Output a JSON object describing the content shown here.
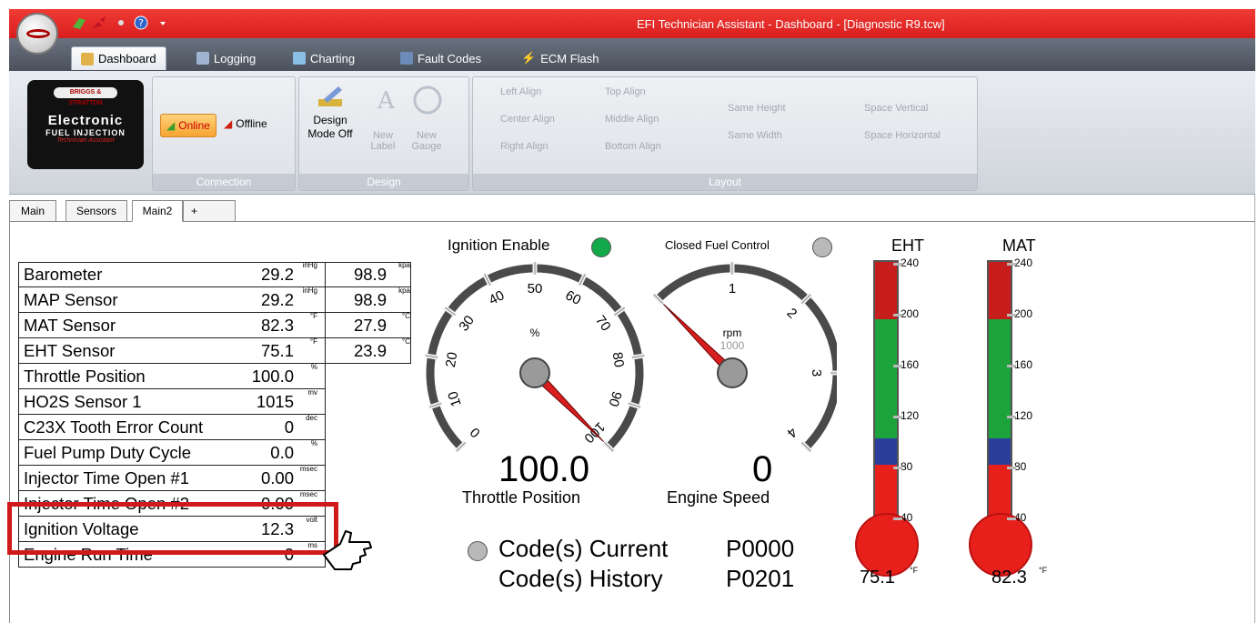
{
  "window": {
    "title": "EFI Technician Assistant - Dashboard - [Diagnostic R9.tcw]"
  },
  "ribbon_tabs": [
    "Dashboard",
    "Logging",
    "Charting",
    "Fault Codes",
    "ECM Flash"
  ],
  "logo": {
    "brand": "BRIGGS & STRATTON",
    "line1": "Electronic",
    "line2": "FUEL INJECTION",
    "line3": "Technician Assistant"
  },
  "connection": {
    "online_label": "Online",
    "offline_label": "Offline",
    "group_label": "Connection"
  },
  "design": {
    "design_mode_label": "Design Mode Off",
    "new_label": "New Label",
    "new_gauge": "New Gauge",
    "group_label": "Design"
  },
  "layout": {
    "left_align": "Left Align",
    "center_align": "Center Align",
    "right_align": "Right Align",
    "top_align": "Top Align",
    "middle_align": "Middle Align",
    "bottom_align": "Bottom Align",
    "equal_height": "Same Height",
    "equal_width": "Same Width",
    "space_vertical": "Space Vertical",
    "space_horizontal": "Space Horizontal",
    "group_label": "Layout"
  },
  "doc_tabs": [
    "Main",
    "Sensors",
    "Main2",
    "+"
  ],
  "sensors": [
    {
      "name": "Barometer",
      "value": "29.2",
      "unit": "inHg",
      "value2": "98.9",
      "unit2": "kpa"
    },
    {
      "name": "MAP Sensor",
      "value": "29.2",
      "unit": "inHg",
      "value2": "98.9",
      "unit2": "kpa"
    },
    {
      "name": "MAT Sensor",
      "value": "82.3",
      "unit": "°F",
      "value2": "27.9",
      "unit2": "°C"
    },
    {
      "name": "EHT Sensor",
      "value": "75.1",
      "unit": "°F",
      "value2": "23.9",
      "unit2": "°C"
    },
    {
      "name": "Throttle Position",
      "value": "100.0",
      "unit": "%"
    },
    {
      "name": "HO2S Sensor 1",
      "value": "1015",
      "unit": "mv"
    },
    {
      "name": "C23X Tooth Error Count",
      "value": "0",
      "unit": "dec"
    },
    {
      "name": "Fuel Pump Duty Cycle",
      "value": "0.0",
      "unit": "%"
    },
    {
      "name": "Injector Time Open #1",
      "value": "0.00",
      "unit": "msec"
    },
    {
      "name": "Injector Time Open #2",
      "value": "0.00",
      "unit": "msec"
    },
    {
      "name": "Ignition Voltage",
      "value": "12.3",
      "unit": "volt"
    },
    {
      "name": "Engine Run Time",
      "value": "0",
      "unit": "ms"
    }
  ],
  "indicators": {
    "ignition_enable": "Ignition Enable",
    "closed_fuel_control": "Closed Fuel Control",
    "ignition_color": "#13a84a",
    "closed_fuel_color": "#b9b9b9"
  },
  "throttle_gauge": {
    "unit": "%",
    "value": "100.0",
    "label": "Throttle Position",
    "ticks": [
      "0",
      "10",
      "20",
      "30",
      "40",
      "50",
      "60",
      "70",
      "80",
      "90",
      "100"
    ],
    "needle_fraction": 1.0
  },
  "speed_gauge": {
    "unit": "rpm",
    "sub": "1000",
    "value": "0",
    "label": "Engine Speed",
    "ticks": [
      "1",
      "2",
      "3",
      "4"
    ],
    "needle_fraction": 0.0
  },
  "codes": {
    "current_label": "Code(s) Current",
    "current_value": "P0000",
    "history_label": "Code(s) History",
    "history_value": "P0201"
  },
  "eht": {
    "label": "EHT",
    "value": "75.1",
    "unit": "°F",
    "ticks": [
      "240",
      "200",
      "160",
      "120",
      "80",
      "40"
    ]
  },
  "mat": {
    "label": "MAT",
    "value": "82.3",
    "unit": "°F",
    "ticks": [
      "240",
      "200",
      "160",
      "120",
      "80",
      "40"
    ]
  }
}
